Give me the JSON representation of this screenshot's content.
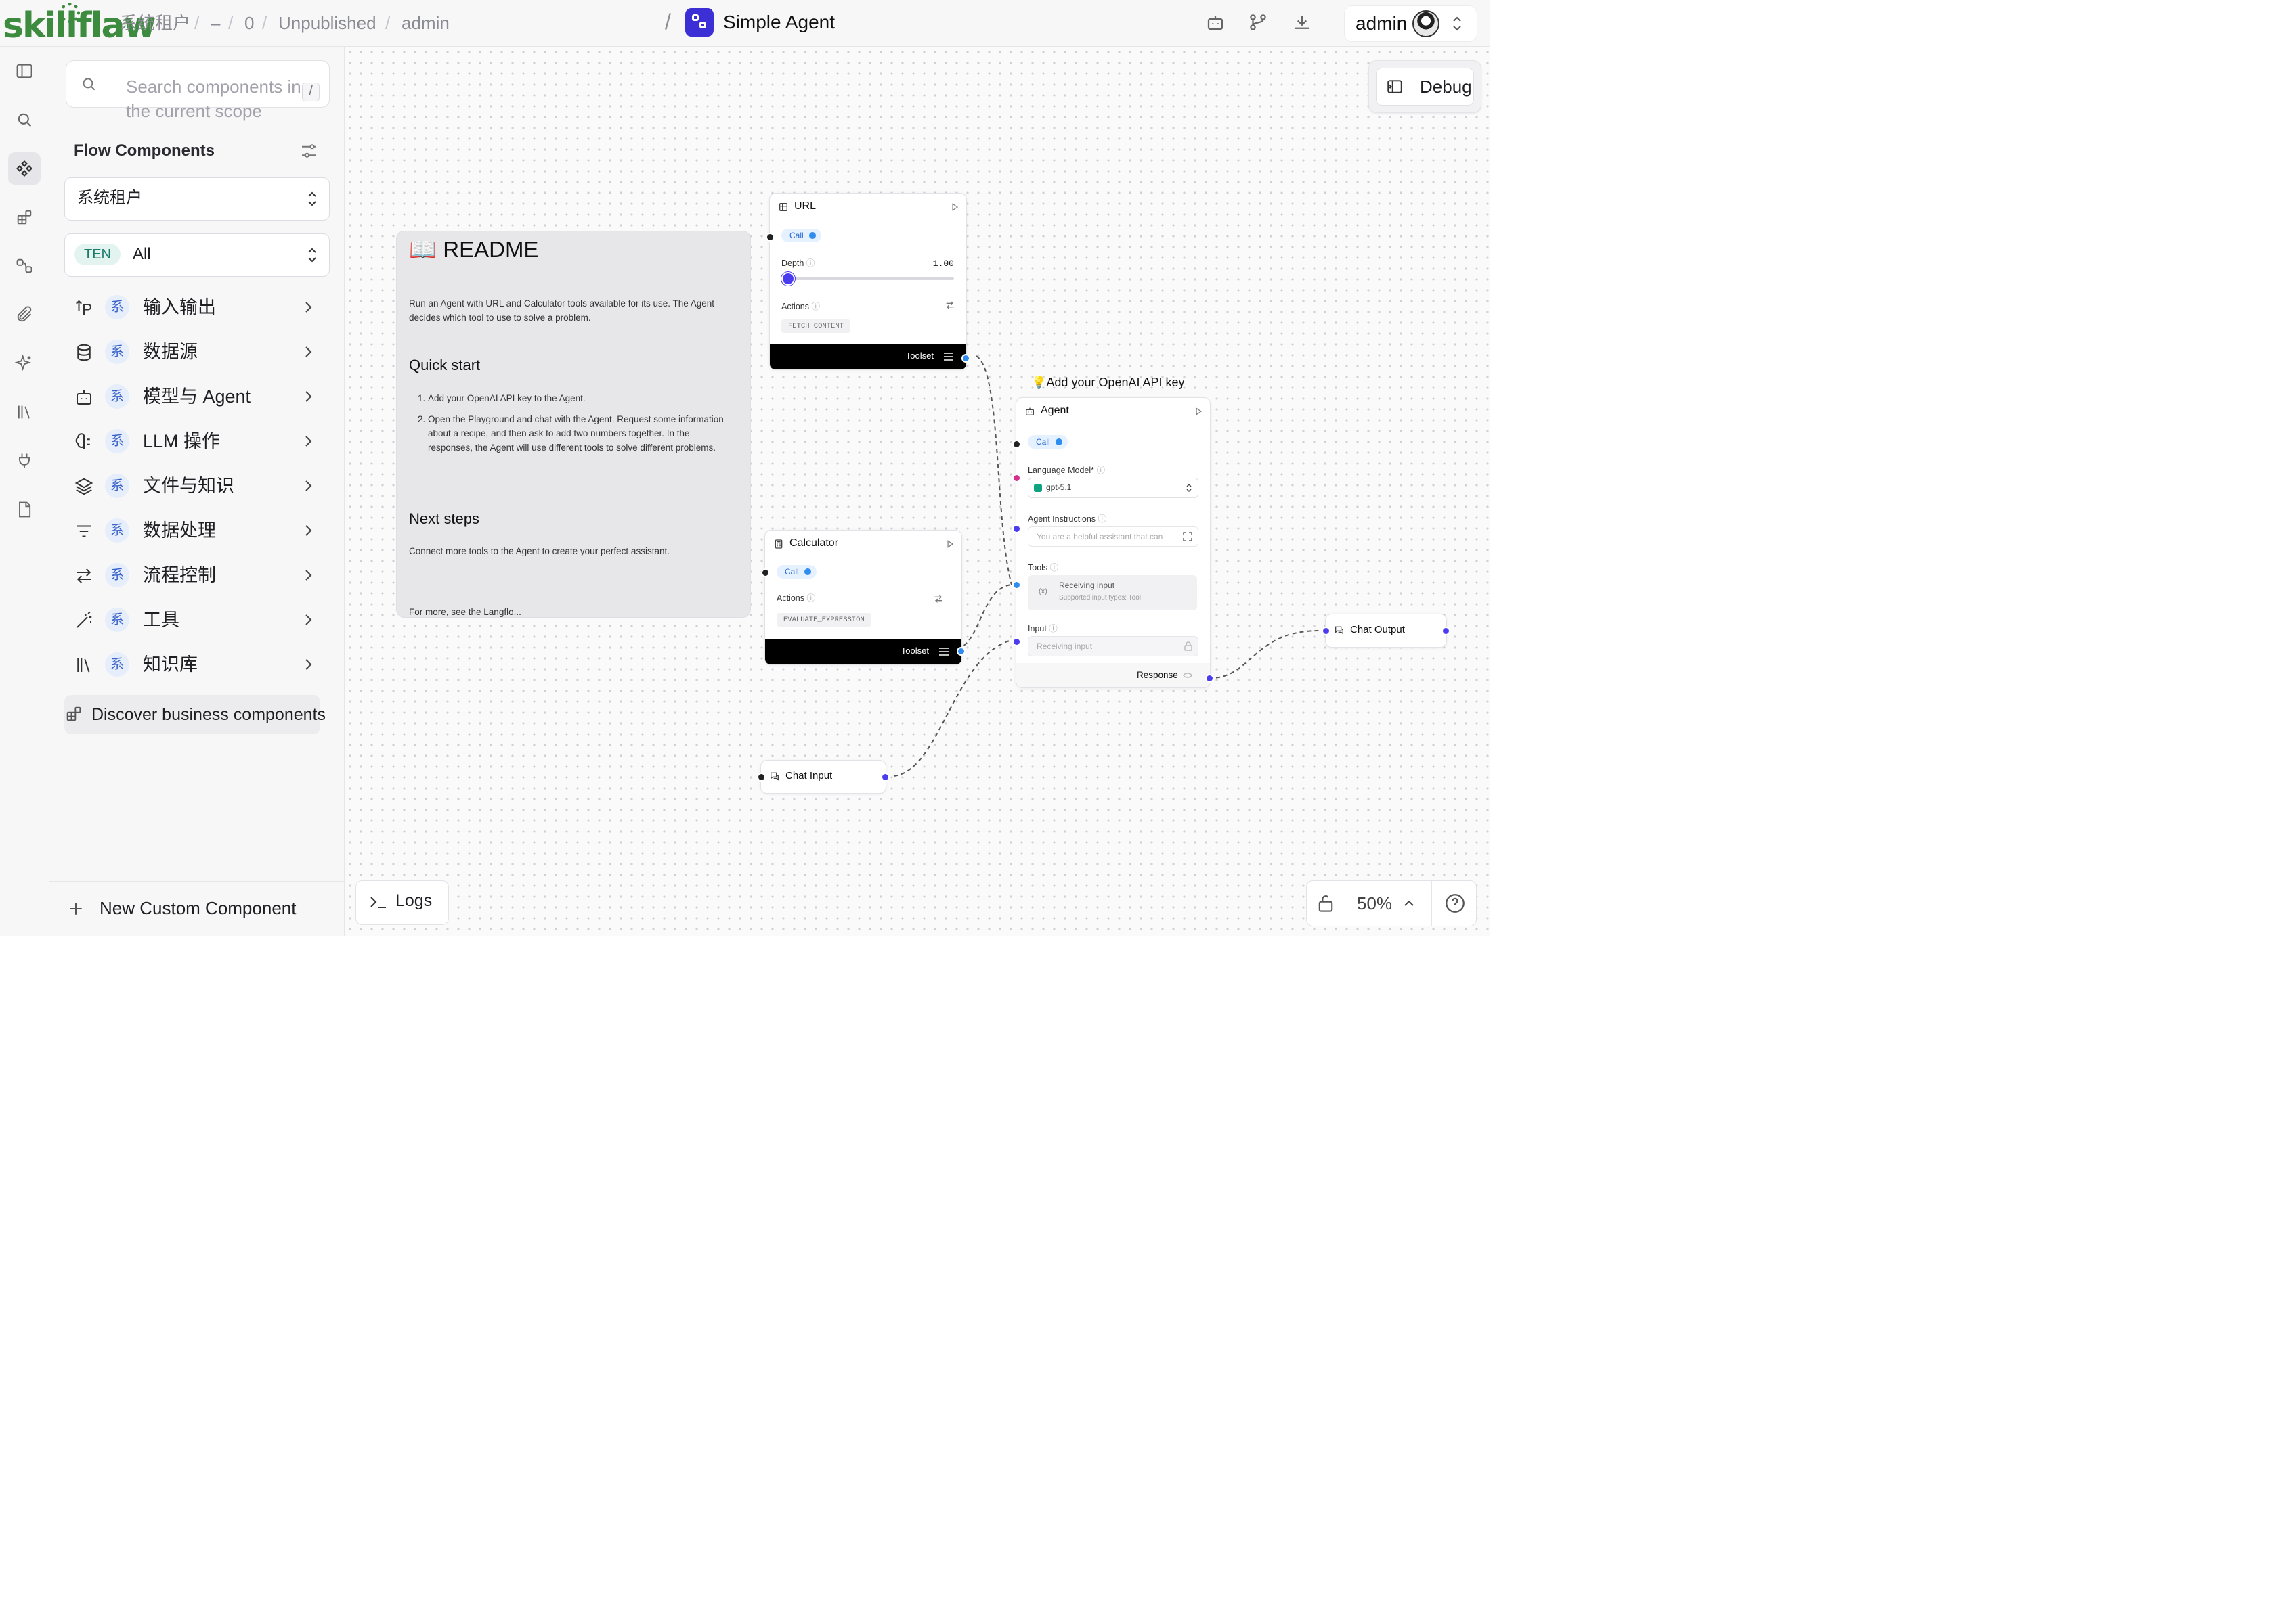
{
  "header": {
    "logo_text": "skillflaw",
    "breadcrumb": [
      "系统租户",
      "–",
      "0",
      "Unpublished",
      "admin"
    ],
    "project_name": "Simple Agent",
    "icons": [
      "bot-icon",
      "git-branch-icon",
      "download-icon"
    ],
    "user": {
      "name": "admin"
    }
  },
  "rail": {
    "items": [
      "panel-toggle-icon",
      "search-icon",
      "components-icon",
      "blocks-icon",
      "flow-icon",
      "paperclip-icon",
      "sparkle-icon",
      "library-icon",
      "plug-icon",
      "file-icon"
    ]
  },
  "sidebar": {
    "search_placeholder": "Search components in the current scope",
    "shortcut": "/",
    "section_title": "Flow Components",
    "tenant_select": "系统租户",
    "scope_badge": "TEN",
    "scope_select": "All",
    "badge_char": "系",
    "categories": [
      {
        "label": "输入输出",
        "icon": "input-output-icon"
      },
      {
        "label": "数据源",
        "icon": "database-icon"
      },
      {
        "label": "模型与 Agent",
        "icon": "bot-icon"
      },
      {
        "label": "LLM 操作",
        "icon": "brain-icon"
      },
      {
        "label": "文件与知识",
        "icon": "layers-icon"
      },
      {
        "label": "数据处理",
        "icon": "filter-icon"
      },
      {
        "label": "流程控制",
        "icon": "arrows-icon"
      },
      {
        "label": "工具",
        "icon": "wand-icon"
      },
      {
        "label": "知识库",
        "icon": "library-icon"
      }
    ],
    "discover_label": "Discover business components",
    "new_component_label": "New Custom Component"
  },
  "canvas": {
    "debug_label": "Debug",
    "logs_label": "Logs",
    "zoom": "50%",
    "readme": {
      "title": "📖 README",
      "intro": "Run an Agent with URL and Calculator tools available for its use. The Agent decides which tool to use to solve a problem.",
      "quick_start_title": "Quick start",
      "quick_start_steps": [
        "Add your OpenAI API key to the Agent.",
        "Open the Playground and chat with the Agent. Request some information about a recipe, and then ask to add two numbers together. In the responses, the Agent will use different tools to solve different problems."
      ],
      "next_steps_title": "Next steps",
      "next_steps_text": "Connect more tools to the Agent to create your perfect assistant.",
      "cut_text": "For more, see the Langflo..."
    },
    "url_node": {
      "title": "URL",
      "call_label": "Call",
      "depth_label": "Depth",
      "depth_value": "1.00",
      "depth_fraction": 0.0,
      "actions_label": "Actions",
      "action_chip": "FETCH_CONTENT",
      "toolset_label": "Toolset"
    },
    "calculator_node": {
      "title": "Calculator",
      "call_label": "Call",
      "actions_label": "Actions",
      "action_chip": "EVALUATE_EXPRESSION",
      "toolset_label": "Toolset"
    },
    "agent_note": "💡Add your OpenAI API key",
    "agent_node": {
      "title": "Agent",
      "call_label": "Call",
      "language_model_label": "Language Model*",
      "language_model_value": "gpt-5.1",
      "instructions_label": "Agent Instructions",
      "instructions_value": "You are a helpful assistant that can",
      "tools_label": "Tools",
      "tools_value": "Receiving input",
      "tools_hint": "Supported input types: Tool",
      "input_label": "Input",
      "input_value": "Receiving input",
      "response_label": "Response"
    },
    "chat_input_node": {
      "title": "Chat Input"
    },
    "chat_output_node": {
      "title": "Chat Output"
    }
  }
}
